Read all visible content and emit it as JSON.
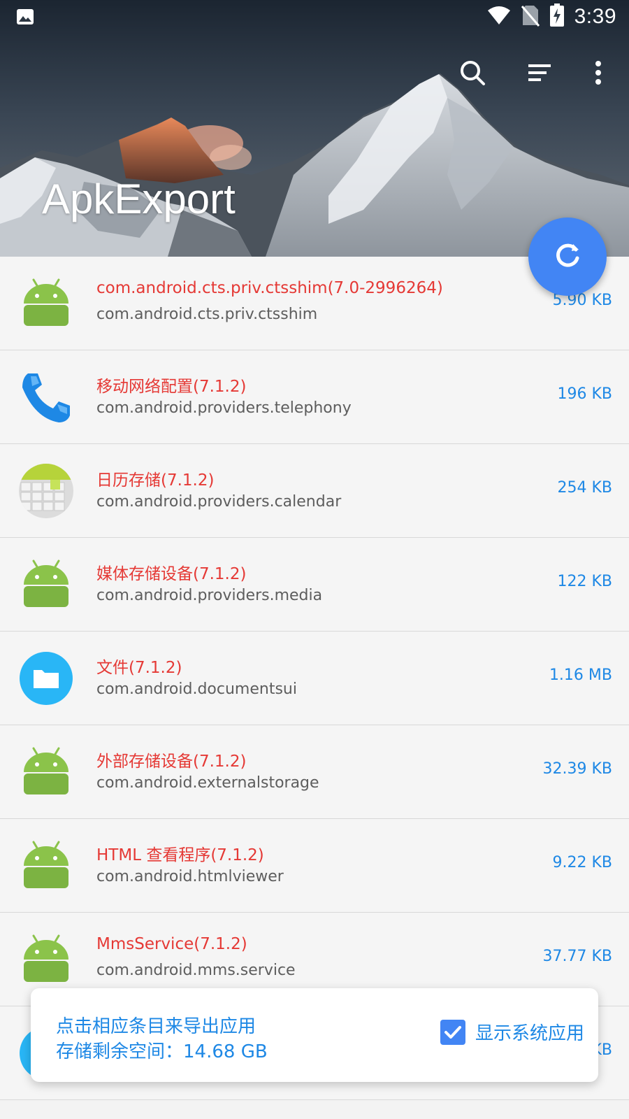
{
  "status_bar": {
    "time": "3:39",
    "icons": [
      "image-icon",
      "wifi-icon",
      "no-sim-icon",
      "battery-charging-icon"
    ]
  },
  "toolbar": {
    "title": "ApkExport",
    "actions": [
      "search-icon",
      "sort-icon",
      "more-vert-icon"
    ]
  },
  "fab": {
    "icon": "refresh-icon",
    "color": "#4285f4"
  },
  "apps": [
    {
      "name": "com.android.cts.priv.ctsshim(7.0-2996264)",
      "package": "com.android.cts.priv.ctsshim",
      "size": "5.90 KB",
      "icon": "android-icon"
    },
    {
      "name": "移动网络配置(7.1.2)",
      "package": "com.android.providers.telephony",
      "size": "196 KB",
      "icon": "phone-icon"
    },
    {
      "name": "日历存储(7.1.2)",
      "package": "com.android.providers.calendar",
      "size": "254 KB",
      "icon": "calendar-icon"
    },
    {
      "name": "媒体存储设备(7.1.2)",
      "package": "com.android.providers.media",
      "size": "122 KB",
      "icon": "android-icon"
    },
    {
      "name": "文件(7.1.2)",
      "package": "com.android.documentsui",
      "size": "1.16 MB",
      "icon": "folder-icon"
    },
    {
      "name": "外部存储设备(7.1.2)",
      "package": "com.android.externalstorage",
      "size": "32.39 KB",
      "icon": "android-icon"
    },
    {
      "name": "HTML 查看程序(7.1.2)",
      "package": "com.android.htmlviewer",
      "size": "9.22 KB",
      "icon": "android-icon"
    },
    {
      "name": "MmsService(7.1.2)",
      "package": "com.android.mms.service",
      "size": "37.77 KB",
      "icon": "android-icon"
    },
    {
      "name": "",
      "package": "",
      "size": "KB",
      "icon": "blue-circle-icon"
    }
  ],
  "info_card": {
    "hint": "点击相应条目来导出应用",
    "storage": "存储剩余空间：14.68 GB",
    "show_system_label": "显示系统应用",
    "show_system_checked": true
  },
  "colors": {
    "accent": "#4285f4",
    "app_name": "#e53935",
    "size_text": "#1e88e5",
    "package_text": "#5d5d5d"
  }
}
